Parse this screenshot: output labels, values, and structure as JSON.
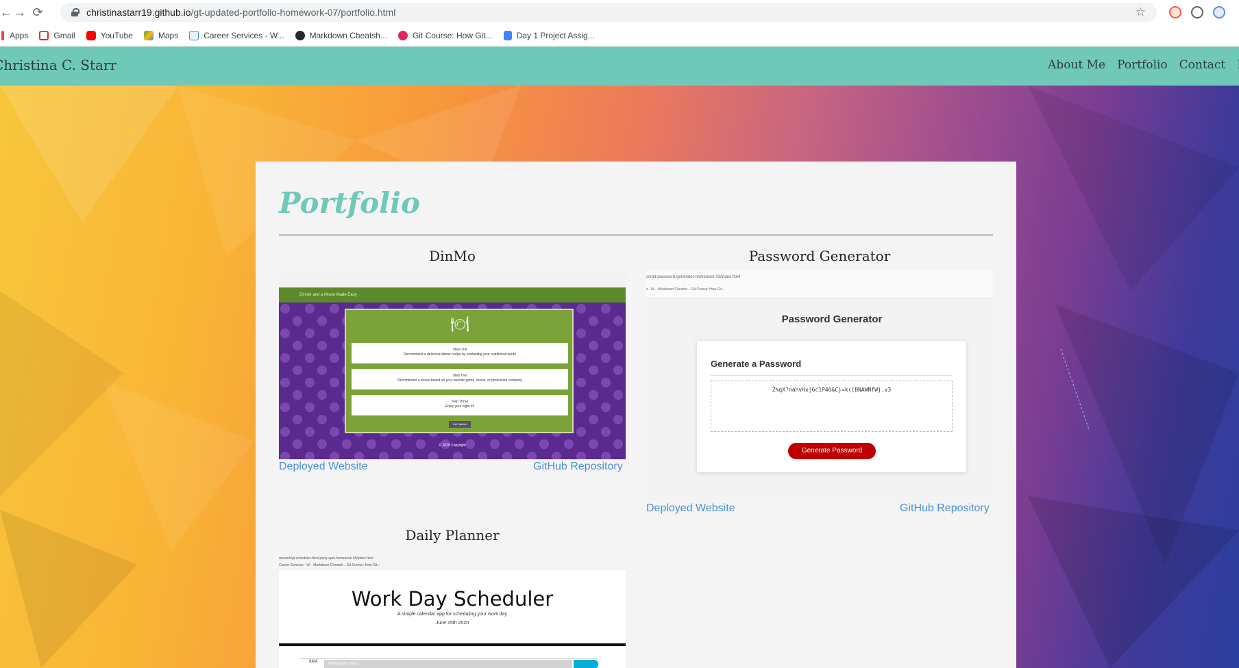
{
  "browser": {
    "url_host": "christinastarr19.github.io",
    "url_path": "/gt-updated-portfolio-homework-07/portfolio.html",
    "bookmarks": [
      {
        "label": "Apps",
        "icon": "apps-grid-icon",
        "color": "#e8453c"
      },
      {
        "label": "Gmail",
        "icon": "gmail-icon",
        "color": "#d93025"
      },
      {
        "label": "YouTube",
        "icon": "youtube-icon",
        "color": "#ff0000"
      },
      {
        "label": "Maps",
        "icon": "maps-icon",
        "color": "#34a853"
      },
      {
        "label": "Career Services - W...",
        "icon": "career-icon",
        "color": "#4a86c5"
      },
      {
        "label": "Markdown Cheatsh...",
        "icon": "github-icon",
        "color": "#24292e"
      },
      {
        "label": "Git Course: How Git...",
        "icon": "course-icon",
        "color": "#e0245e"
      },
      {
        "label": "Day 1 Project Assig...",
        "icon": "docs-icon",
        "color": "#4285f4"
      }
    ]
  },
  "site": {
    "brand": "Christina C. Starr",
    "nav": [
      "About Me",
      "Portfolio",
      "Contact",
      "R"
    ],
    "accent": "#70c9b8"
  },
  "portfolio": {
    "title": "Portfolio",
    "projects": [
      {
        "title": "DinMo",
        "deployed_label": "Deployed Website",
        "repo_label": "GitHub Repository",
        "thumb": {
          "header": "Dinner and a Movie Made Easy",
          "header_right": "About\nCredit",
          "steps": [
            {
              "title": "Step One",
              "text": "Recommend a delicious dinner recipe by evaluating your nutritional needs"
            },
            {
              "title": "Step Two",
              "text": "Recommend a movie based on your favorite genre, movie, or production company"
            },
            {
              "title": "Step Three",
              "text": "Enjoy your night in!"
            }
          ],
          "button": "Get Started",
          "copyright": "© 2020 Copyright"
        }
      },
      {
        "title": "Password Generator",
        "deployed_label": "Deployed Website",
        "repo_label": "GitHub Repository",
        "thumb": {
          "url": "script-password-generator-homework-03/index.html",
          "bookmarks": "s - W...   Markdown Cheatsh...   Git Course: How Git...",
          "heading": "Password Generator",
          "card_title": "Generate a Password",
          "password": "Z%qX?nahvHx|6c1P40&Cj=k([BNAWNfWj.v3",
          "button": "Generate Password"
        }
      },
      {
        "title": "Daily Planner",
        "thumb": {
          "url": "mework/gt-scheduler-third-party-apis-homework-05/index.html",
          "bookmarks": "Career Services - W...   Markdown Cheatsh...   Git Course: How Git...",
          "title": "Work Day Scheduler",
          "subtitle": "A simple calendar app for scheduling your work day",
          "date": "June 15th 2020",
          "hour": "9AM",
          "slot_text": "Workout with trainer"
        }
      }
    ]
  }
}
